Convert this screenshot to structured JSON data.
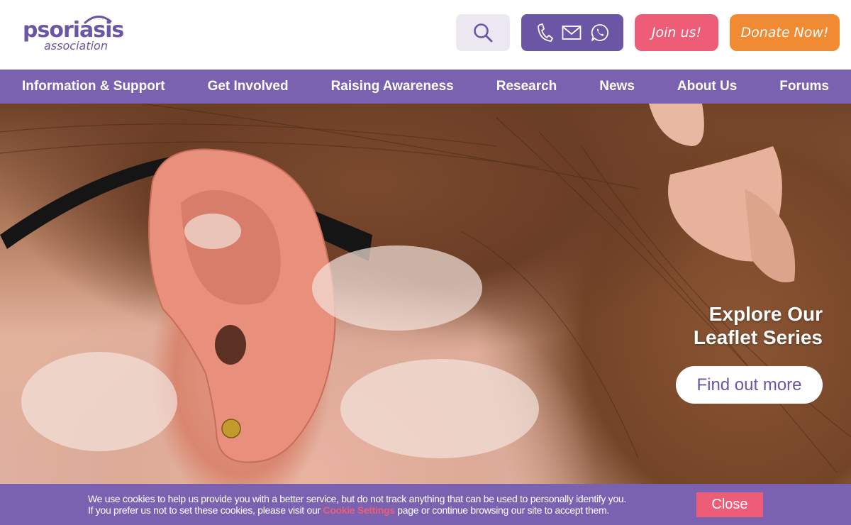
{
  "header": {
    "logo_main": "psoriasis",
    "logo_sub": "association",
    "join_label": "Join us!",
    "donate_label": "Donate Now!"
  },
  "icons": {
    "search": "search-icon",
    "phone": "phone-icon",
    "email": "email-icon",
    "whatsapp": "whatsapp-icon"
  },
  "nav": {
    "items": [
      {
        "label": "Information & Support"
      },
      {
        "label": "Get Involved"
      },
      {
        "label": "Raising Awareness"
      },
      {
        "label": "Research"
      },
      {
        "label": "News"
      },
      {
        "label": "About Us"
      },
      {
        "label": "Forums"
      }
    ]
  },
  "hero": {
    "title_line1": "Explore Our",
    "title_line2": "Leaflet Series",
    "button_label": "Find out more"
  },
  "cookie": {
    "text_line1": "We use cookies to help us provide you with a better service, but do not track anything that can be used to personally identify you.",
    "text_line2_before": "If you prefer us not to set these cookies, please visit our ",
    "link_label": "Cookie Settings",
    "text_line2_after": " page or continue browsing our site to accept them.",
    "close_label": "Close"
  },
  "colors": {
    "brand_purple": "#6b55a5",
    "nav_purple": "#7a62b0",
    "pink": "#ee5d78",
    "orange": "#f08a33",
    "search_bg": "#ece8f2"
  }
}
